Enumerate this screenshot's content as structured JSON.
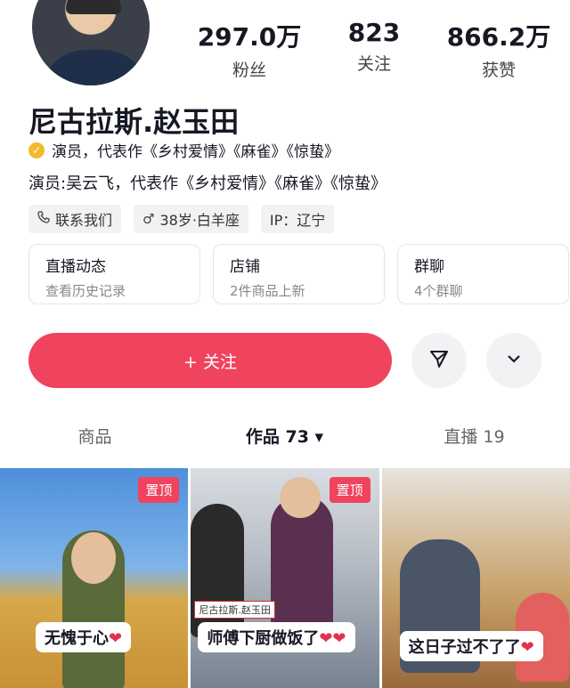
{
  "profile": {
    "name": "尼古拉斯.赵玉田",
    "verified_text": "演员，代表作《乡村爱情》《麻雀》《惊蛰》",
    "bio": "演员:吴云飞，代表作《乡村爱情》《麻雀》《惊蛰》"
  },
  "stats": [
    {
      "value": "297.0万",
      "label": "粉丝"
    },
    {
      "value": "823",
      "label": "关注"
    },
    {
      "value": "866.2万",
      "label": "获赞"
    }
  ],
  "tags": {
    "contact": "联系我们",
    "age": "38岁·白羊座",
    "ip": "IP：辽宁"
  },
  "cards": [
    {
      "title": "直播动态",
      "sub": "查看历史记录"
    },
    {
      "title": "店铺",
      "sub": "2件商品上新"
    },
    {
      "title": "群聊",
      "sub": "4个群聊"
    }
  ],
  "actions": {
    "follow_label": "+ 关注"
  },
  "tabs": [
    {
      "label": "商品"
    },
    {
      "label": "作品 73 ▾"
    },
    {
      "label": "直播 19"
    }
  ],
  "videos": [
    {
      "pinned": "置顶",
      "caption": "无愧于心"
    },
    {
      "pinned": "置顶",
      "caption": "师傅下厨做饭了",
      "overlay": "尼古拉斯.赵玉田"
    },
    {
      "caption": "这日子过不了了"
    }
  ],
  "colors": {
    "accent": "#f0435e",
    "verified": "#f3b92c"
  }
}
